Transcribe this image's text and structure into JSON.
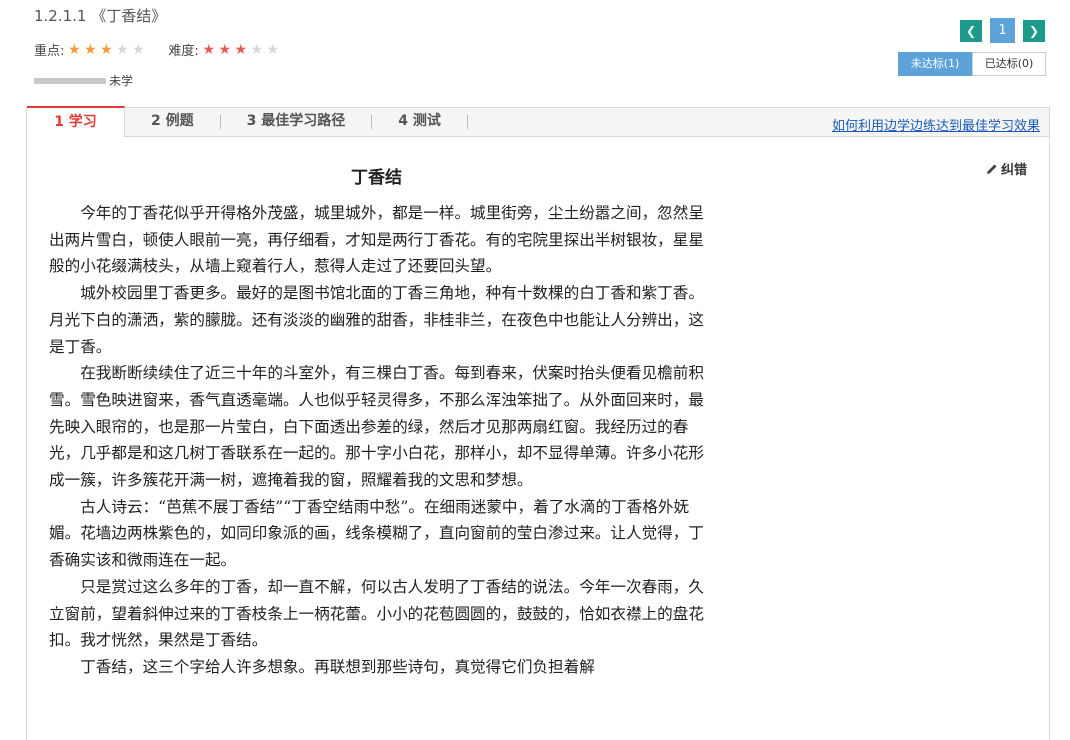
{
  "lesson": {
    "title": "1.2.1.1 《丁香结》"
  },
  "ratings": {
    "importance_label": "重点:",
    "importance_stars": 3,
    "difficulty_label": "难度:",
    "difficulty_stars": 3,
    "max_stars": 5,
    "colors": {
      "importance": "#f39c3e",
      "difficulty": "#e85a5a",
      "empty": "#d8d8d8"
    }
  },
  "progress": {
    "status_label": "未学",
    "fill": 0
  },
  "pager": {
    "prev_icon": "chevron-left-icon",
    "current_page": "1",
    "next_icon": "chevron-right-icon"
  },
  "status_tabs": {
    "unmet": "未达标(1)",
    "met": "已达标(0)"
  },
  "tabs": [
    {
      "label": "1 学习"
    },
    {
      "label": "2 例题"
    },
    {
      "label": "3 最佳学习路径"
    },
    {
      "label": "4 测试"
    }
  ],
  "tab_link": "如何利用边学边练达到最佳学习效果",
  "article": {
    "title": "丁香结",
    "report_label": "纠错",
    "paragraphs": [
      "今年的丁香花似乎开得格外茂盛，城里城外，都是一样。城里街旁，尘土纷嚣之间，忽然呈出两片雪白，顿使人眼前一亮，再仔细看，才知是两行丁香花。有的宅院里探出半树银妆，星星般的小花缀满枝头，从墙上窥着行人，惹得人走过了还要回头望。",
      "城外校园里丁香更多。最好的是图书馆北面的丁香三角地，种有十数棵的白丁香和紫丁香。月光下白的潇洒，紫的朦胧。还有淡淡的幽雅的甜香，非桂非兰，在夜色中也能让人分辨出，这是丁香。",
      "在我断断续续住了近三十年的斗室外，有三棵白丁香。每到春来，伏案时抬头便看见檐前积雪。雪色映进窗来，香气直透毫端。人也似乎轻灵得多，不那么浑浊笨拙了。从外面回来时，最先映入眼帘的，也是那一片莹白，白下面透出参差的绿，然后才见那两扇红窗。我经历过的春光，几乎都是和这几树丁香联系在一起的。那十字小白花，那样小，却不显得单薄。许多小花形成一簇，许多簇花开满一树，遮掩着我的窗，照耀着我的文思和梦想。",
      "古人诗云：“芭蕉不展丁香结”“丁香空结雨中愁”。在细雨迷蒙中，着了水滴的丁香格外妩媚。花墙边两株紫色的，如同印象派的画，线条模糊了，直向窗前的莹白渗过来。让人觉得，丁香确实该和微雨连在一起。",
      "只是赏过这么多年的丁香，却一直不解，何以古人发明了丁香结的说法。今年一次春雨，久立窗前，望着斜伸过来的丁香枝条上一柄花蕾。小小的花苞圆圆的，鼓鼓的，恰如衣襟上的盘花扣。我才恍然，果然是丁香结。",
      "丁香结，这三个字给人许多想象。再联想到那些诗句，真觉得它们负担着解"
    ]
  }
}
